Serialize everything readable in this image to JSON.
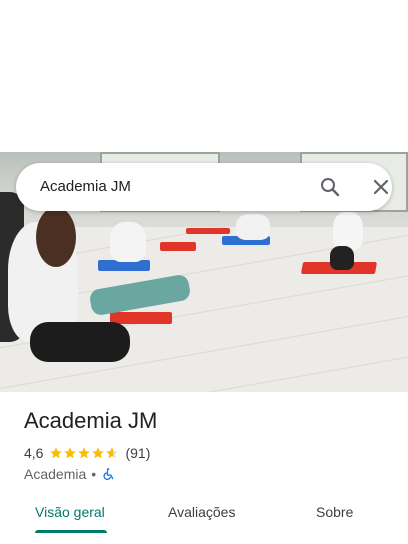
{
  "search": {
    "query": "Academia JM"
  },
  "place": {
    "title": "Academia JM",
    "rating": "4,6",
    "stars": 4.6,
    "review_count": "(91)",
    "category": "Academia",
    "separator": "•"
  },
  "tabs": [
    {
      "label": "Visão geral",
      "active": true
    },
    {
      "label": "Avaliações",
      "active": false
    },
    {
      "label": "Sobre",
      "active": false
    }
  ],
  "colors": {
    "accent": "#00796b",
    "star": "#fbbc04",
    "accessibility": "#1a73e8"
  },
  "icons": [
    "search-icon",
    "close-icon",
    "star-icon",
    "wheelchair-icon"
  ]
}
